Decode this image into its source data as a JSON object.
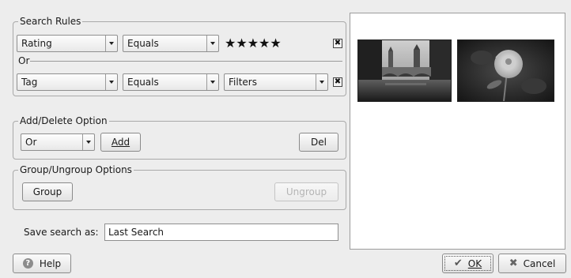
{
  "search_rules": {
    "legend": "Search Rules",
    "rule1": {
      "field": "Rating",
      "operator": "Equals",
      "stars": "★★★★★",
      "remove_glyph": "✖"
    },
    "connector": "Or",
    "rule2": {
      "field": "Tag",
      "operator": "Equals",
      "value": "Filters",
      "remove_glyph": "✖"
    }
  },
  "add_delete": {
    "legend": "Add/Delete Option",
    "option": "Or",
    "add_label": "Add",
    "del_label": "Del"
  },
  "group_ungroup": {
    "legend": "Group/Ungroup Options",
    "group_label": "Group",
    "ungroup_label": "Ungroup"
  },
  "save": {
    "label": "Save search as:",
    "value": "Last Search"
  },
  "footer": {
    "help_label": "Help",
    "help_icon": "help-icon",
    "ok_label": "OK",
    "ok_icon": "checkmark-icon",
    "cancel_label": "Cancel",
    "cancel_icon": "cancel-icon"
  },
  "preview": {
    "thumbnails": [
      "castle-bridge-photo",
      "rose-photo"
    ]
  }
}
